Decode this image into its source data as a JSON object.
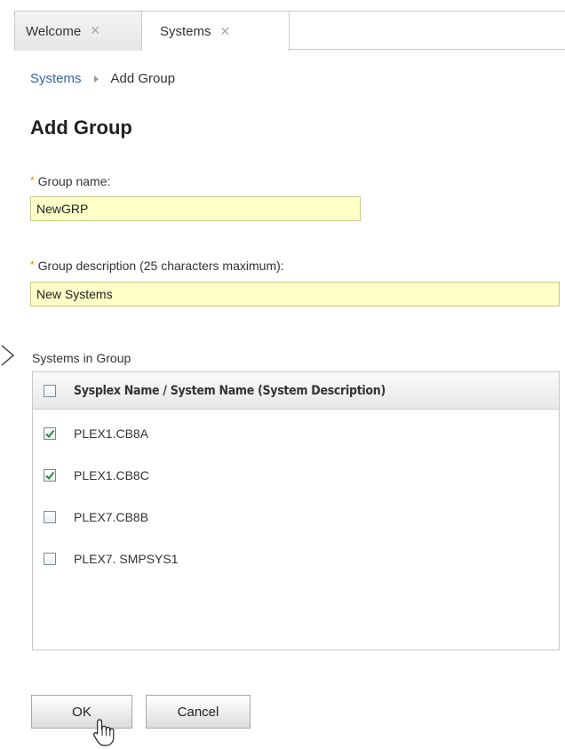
{
  "tabs": [
    {
      "label": "Welcome",
      "close": "✕"
    },
    {
      "label": "Systems",
      "close": "✕"
    }
  ],
  "breadcrumb": {
    "parent": "Systems",
    "current": "Add Group"
  },
  "page_title": "Add Group",
  "form": {
    "group_name": {
      "label": "Group name:",
      "value": "NewGRP"
    },
    "group_description": {
      "label": "Group description (25 characters maximum):",
      "value": "New Systems"
    },
    "required_marker": "*"
  },
  "systems_section": {
    "label": "Systems in Group",
    "header": "Sysplex Name / System Name (System Description)",
    "select_all_checked": false,
    "rows": [
      {
        "name": "PLEX1.CB8A",
        "checked": true
      },
      {
        "name": "PLEX1.CB8C",
        "checked": true
      },
      {
        "name": "PLEX7.CB8B",
        "checked": false
      },
      {
        "name": "PLEX7. SMPSYS1",
        "checked": false
      }
    ]
  },
  "buttons": {
    "ok": "OK",
    "cancel": "Cancel"
  },
  "icons": {
    "tab_close": "close-icon",
    "breadcrumb_separator": "chevron-right-icon",
    "pointer": "arrow-pointer-icon",
    "cursor": "hand-cursor-icon",
    "checkmark": "checkmark-icon"
  },
  "colors": {
    "link": "#3366aa",
    "input_background": "#ffffc8",
    "required": "#c9a000",
    "check": "#2e8b2e"
  }
}
